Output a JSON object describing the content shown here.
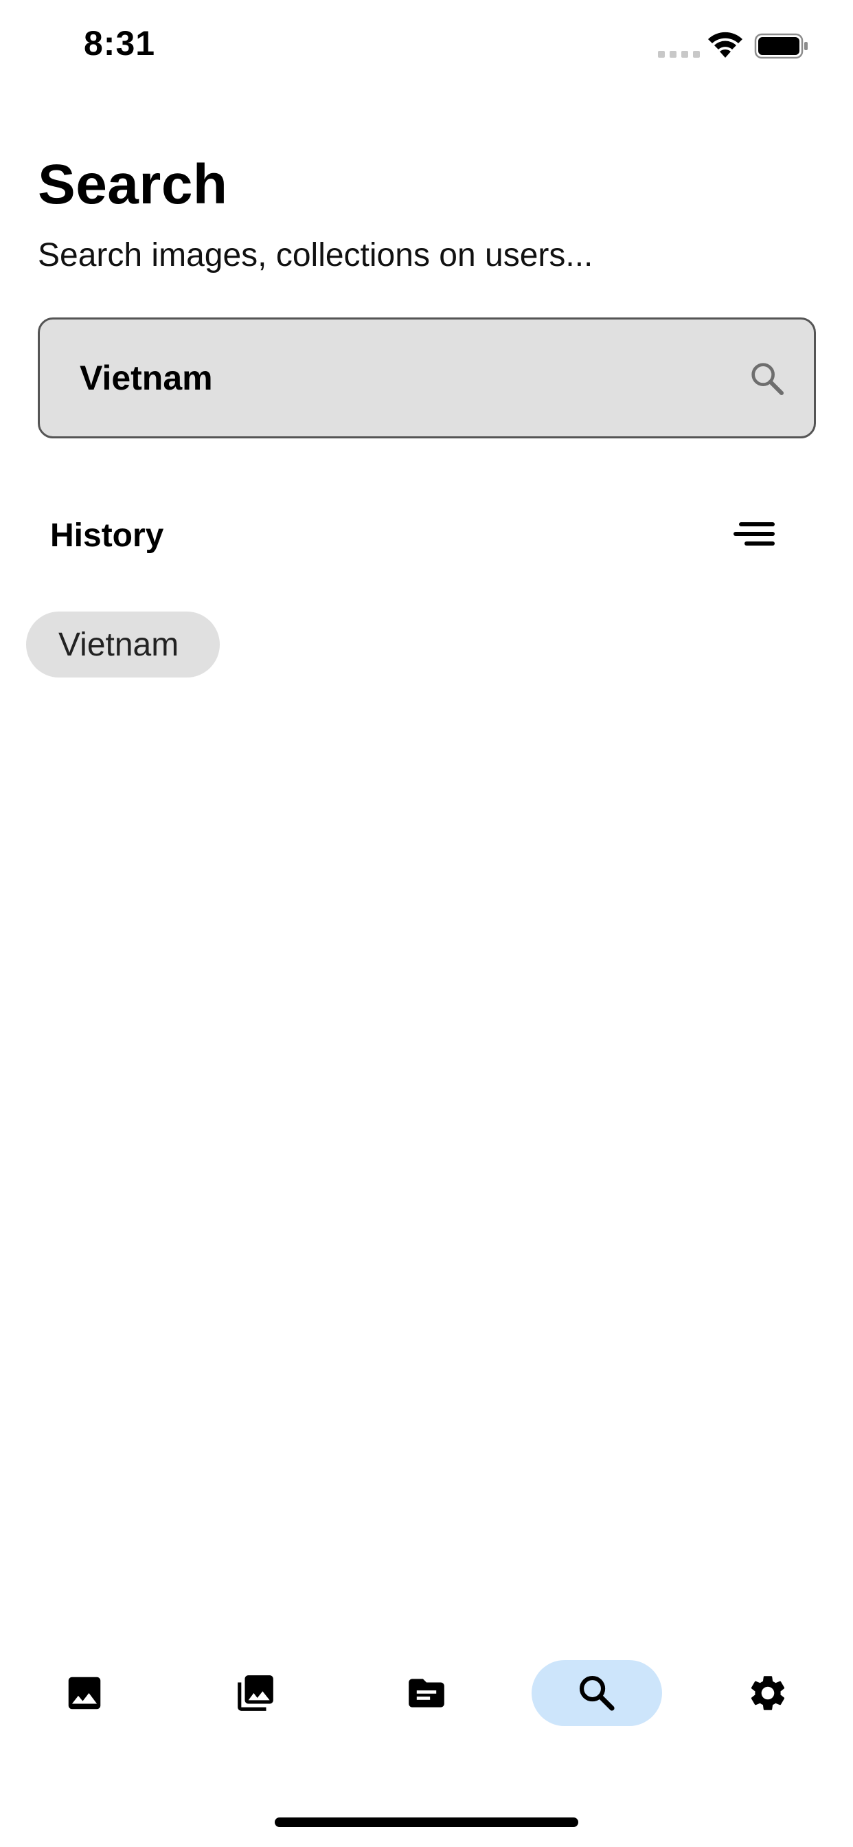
{
  "status_bar": {
    "time": "8:31",
    "icons": [
      "signal-icon",
      "wifi-icon",
      "battery-icon"
    ]
  },
  "header": {
    "title": "Search",
    "subtitle": "Search images, collections on users..."
  },
  "search": {
    "value": "Vietnam",
    "placeholder": "",
    "icon": "search-icon"
  },
  "history": {
    "label": "History",
    "sort_icon": "sort-icon",
    "chips": [
      "Vietnam"
    ]
  },
  "bottom_nav": {
    "items": [
      {
        "icon": "image-icon",
        "active": false
      },
      {
        "icon": "photo-library-icon",
        "active": false
      },
      {
        "icon": "folder-icon",
        "active": false
      },
      {
        "icon": "search-icon",
        "active": true
      },
      {
        "icon": "settings-icon",
        "active": false
      }
    ]
  },
  "colors": {
    "background": "#ffffff",
    "search_fill": "#e0e0e0",
    "search_border": "#555555",
    "chip_fill": "#e0e0e0",
    "nav_active": "#cde5fb",
    "text": "#000000"
  }
}
